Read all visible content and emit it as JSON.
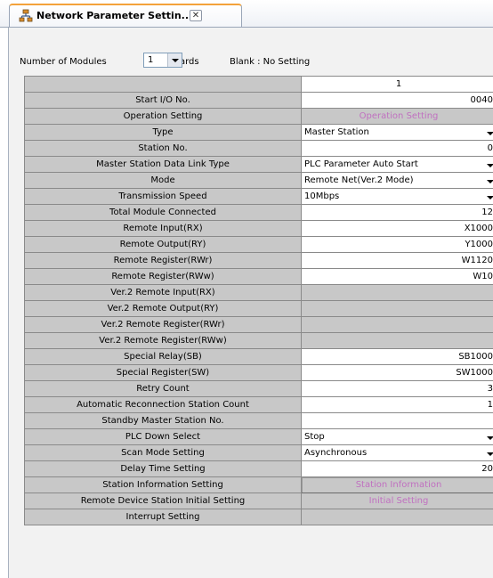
{
  "tab": {
    "title": "Network Parameter Settin...",
    "close": "✕",
    "icon": "network-icon"
  },
  "modules": {
    "label": "Number of Modules",
    "value": "1",
    "unit": "Boards",
    "hint": "Blank : No Setting"
  },
  "column_header": "1",
  "rows": [
    {
      "label": "Start I/O No.",
      "kind": "val",
      "value": "0040"
    },
    {
      "label": "Operation Setting",
      "kind": "btn",
      "value": "Operation Setting"
    },
    {
      "label": "Type",
      "kind": "sel",
      "value": "Master Station"
    },
    {
      "label": "Station No.",
      "kind": "val",
      "value": "0"
    },
    {
      "label": "Master Station Data Link Type",
      "kind": "sel",
      "value": "PLC Parameter Auto Start"
    },
    {
      "label": "Mode",
      "kind": "sel",
      "value": "Remote Net(Ver.2 Mode)"
    },
    {
      "label": "Transmission Speed",
      "kind": "sel",
      "value": "10Mbps"
    },
    {
      "label": "Total Module Connected",
      "kind": "val",
      "value": "12"
    },
    {
      "label": "Remote Input(RX)",
      "kind": "val",
      "value": "X1000"
    },
    {
      "label": "Remote Output(RY)",
      "kind": "val",
      "value": "Y1000"
    },
    {
      "label": "Remote Register(RWr)",
      "kind": "val",
      "value": "W1120"
    },
    {
      "label": "Remote Register(RWw)",
      "kind": "val",
      "value": "W10"
    },
    {
      "label": "Ver.2 Remote Input(RX)",
      "kind": "dis",
      "value": ""
    },
    {
      "label": "Ver.2 Remote Output(RY)",
      "kind": "dis",
      "value": ""
    },
    {
      "label": "Ver.2 Remote Register(RWr)",
      "kind": "dis",
      "value": ""
    },
    {
      "label": "Ver.2 Remote Register(RWw)",
      "kind": "dis",
      "value": ""
    },
    {
      "label": "Special Relay(SB)",
      "kind": "val",
      "value": "SB1000"
    },
    {
      "label": "Special Register(SW)",
      "kind": "val",
      "value": "SW1000"
    },
    {
      "label": "Retry Count",
      "kind": "val",
      "value": "3"
    },
    {
      "label": "Automatic Reconnection Station Count",
      "kind": "val",
      "value": "1"
    },
    {
      "label": "Standby Master Station No.",
      "kind": "val",
      "value": ""
    },
    {
      "label": "PLC Down Select",
      "kind": "sel",
      "value": "Stop"
    },
    {
      "label": "Scan Mode Setting",
      "kind": "sel",
      "value": "Asynchronous"
    },
    {
      "label": "Delay Time Setting",
      "kind": "val",
      "value": "20"
    },
    {
      "label": "Station Information Setting",
      "kind": "btn-inset",
      "value": "Station Information"
    },
    {
      "label": "Remote Device Station Initial Setting",
      "kind": "btn",
      "value": "Initial Setting"
    },
    {
      "label": "Interrupt Setting",
      "kind": "dis",
      "value": ""
    }
  ]
}
